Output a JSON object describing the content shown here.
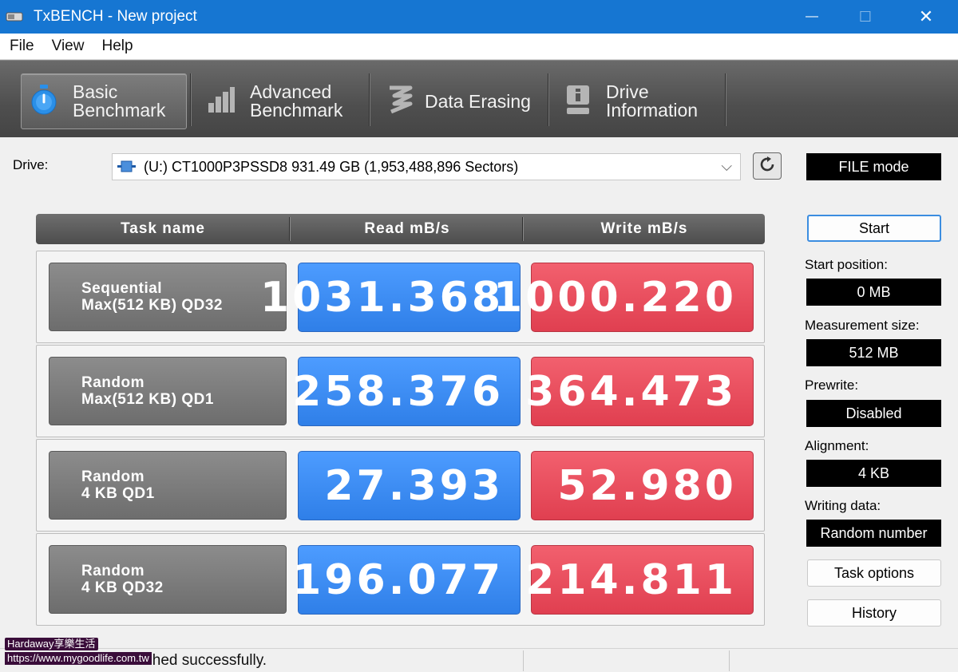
{
  "window": {
    "title": "TxBENCH - New project",
    "minimize": "—",
    "maximize": "☐",
    "close": "✕"
  },
  "menu": [
    "File",
    "View",
    "Help"
  ],
  "tabs": [
    {
      "line1": "Basic",
      "line2": "Benchmark",
      "active": true
    },
    {
      "line1": "Advanced",
      "line2": "Benchmark",
      "active": false
    },
    {
      "line1": "Data Erasing",
      "line2": "",
      "active": false
    },
    {
      "line1": "Drive",
      "line2": "Information",
      "active": false
    }
  ],
  "drive": {
    "label": "Drive:",
    "selected": "(U:) CT1000P3PSSD8  931.49 GB (1,953,488,896 Sectors)"
  },
  "table": {
    "headers": [
      "Task name",
      "Read mB/s",
      "Write mB/s"
    ],
    "rows": [
      {
        "task1": "Sequential",
        "task2": "Max(512 KB) QD32",
        "read": "1031.368",
        "write": "1000.220"
      },
      {
        "task1": "Random",
        "task2": "Max(512 KB) QD1",
        "read": "258.376",
        "write": "364.473"
      },
      {
        "task1": "Random",
        "task2": "4 KB QD1",
        "read": "27.393",
        "write": "52.980"
      },
      {
        "task1": "Random",
        "task2": "4 KB QD32",
        "read": "196.077",
        "write": "214.811"
      }
    ]
  },
  "panel": {
    "mode": "FILE mode",
    "start_button": "Start",
    "start_position_label": "Start position:",
    "start_position": "0 MB",
    "measurement_size_label": "Measurement size:",
    "measurement_size": "512 MB",
    "prewrite_label": "Prewrite:",
    "prewrite": "Disabled",
    "alignment_label": "Alignment:",
    "alignment": "4 KB",
    "writing_data_label": "Writing data:",
    "writing_data": "Random number",
    "task_options_button": "Task options",
    "history_button": "History"
  },
  "status": {
    "text": "Basic benchmark finished successfully."
  },
  "watermark": {
    "line1": "Hardaway享樂生活",
    "line2": "https://www.mygoodlife.com.tw"
  },
  "colors": {
    "titlebar": "#1676d2",
    "read": "#3a8cf5",
    "write": "#e84c5b"
  }
}
